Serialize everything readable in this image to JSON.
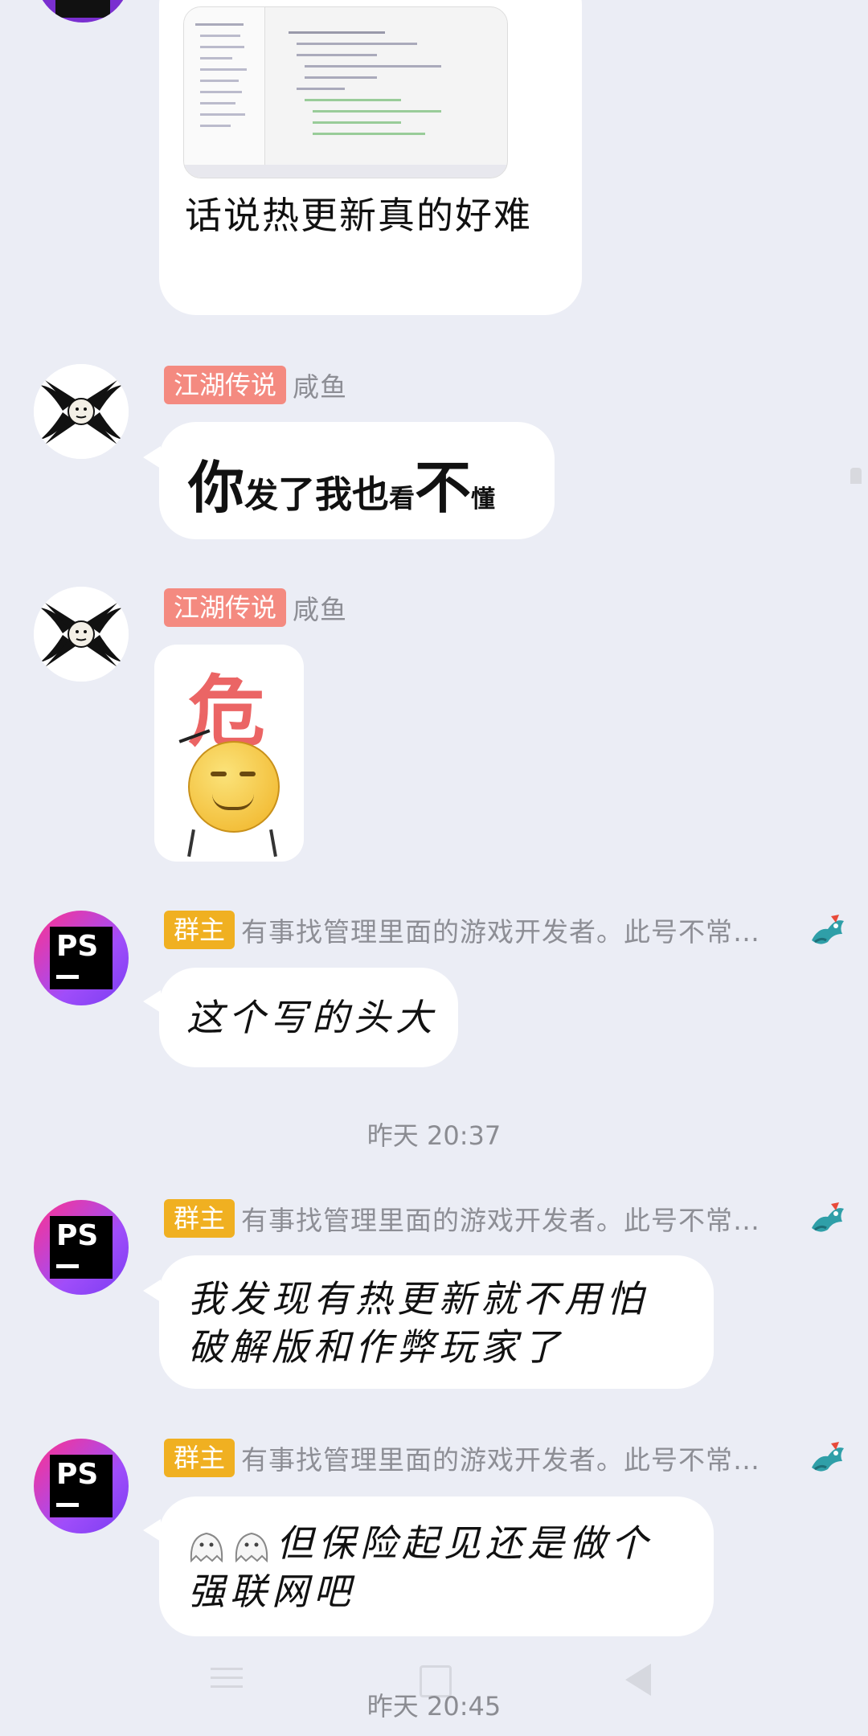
{
  "messages": [
    {
      "text": "话说热更新真的好难"
    },
    {
      "tag": "江湖传说",
      "nick": "咸鱼",
      "text_parts": [
        "你",
        "发",
        "了",
        "我",
        "也",
        "看",
        "不",
        "懂"
      ]
    },
    {
      "tag": "江湖传说",
      "nick": "咸鱼",
      "sticker_text": "危"
    },
    {
      "tag": "群主",
      "nick": "有事找管理里面的游戏开发者。此号不常…",
      "text": "这个写的头大"
    },
    {
      "tag": "群主",
      "nick": "有事找管理里面的游戏开发者。此号不常…",
      "text": "我发现有热更新就不用怕破解版和作弊玩家了"
    },
    {
      "tag": "群主",
      "nick": "有事找管理里面的游戏开发者。此号不常…",
      "text": "但保险起见还是做个强联网吧"
    }
  ],
  "timestamps": {
    "first": "昨天 20:37",
    "second": "昨天 20:45"
  },
  "avatar_ps_label": "PS",
  "colors": {
    "background": "#ebedf5",
    "bubble": "#ffffff",
    "tag_legend": "#f48a80",
    "tag_owner": "#f0b021",
    "nick": "#8d8e95"
  },
  "icons": {
    "nav_back": "triangle-back-icon",
    "nav_home": "square-home-icon",
    "nav_menu": "menu-lines-icon"
  }
}
